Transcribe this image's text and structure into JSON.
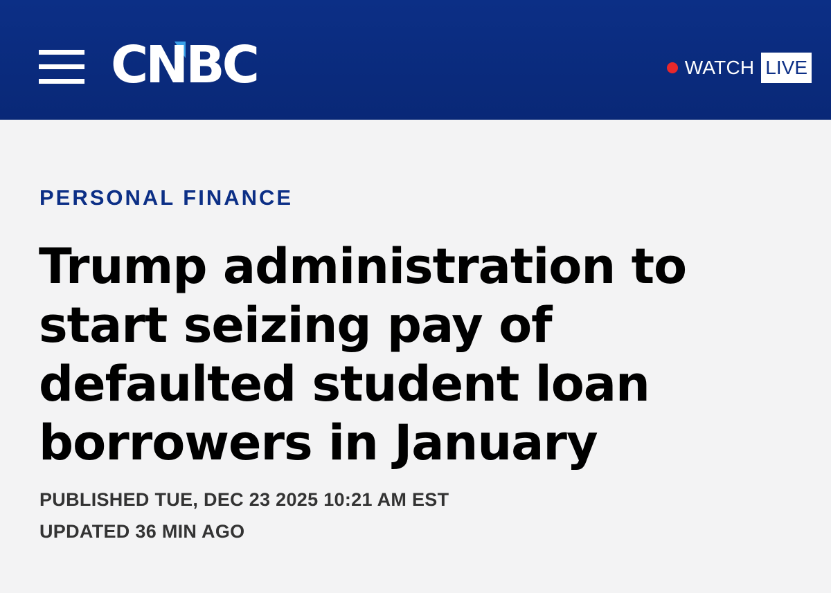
{
  "header": {
    "logo_text": "CNBC",
    "watch_label": "WATCH",
    "live_label": "LIVE",
    "colors": {
      "brand_blue": "#0c2f86",
      "live_dot": "#e8282b"
    },
    "icons": {
      "menu": "hamburger-menu-icon",
      "live_indicator": "red-dot-icon"
    }
  },
  "article": {
    "section": "PERSONAL FINANCE",
    "headline_lines": [
      "Trump administration to",
      "start seizing pay of",
      "defaulted student loan",
      "borrowers in January"
    ],
    "published": "PUBLISHED TUE, DEC 23 2025 10:21 AM EST",
    "updated": "UPDATED 36 MIN AGO"
  }
}
